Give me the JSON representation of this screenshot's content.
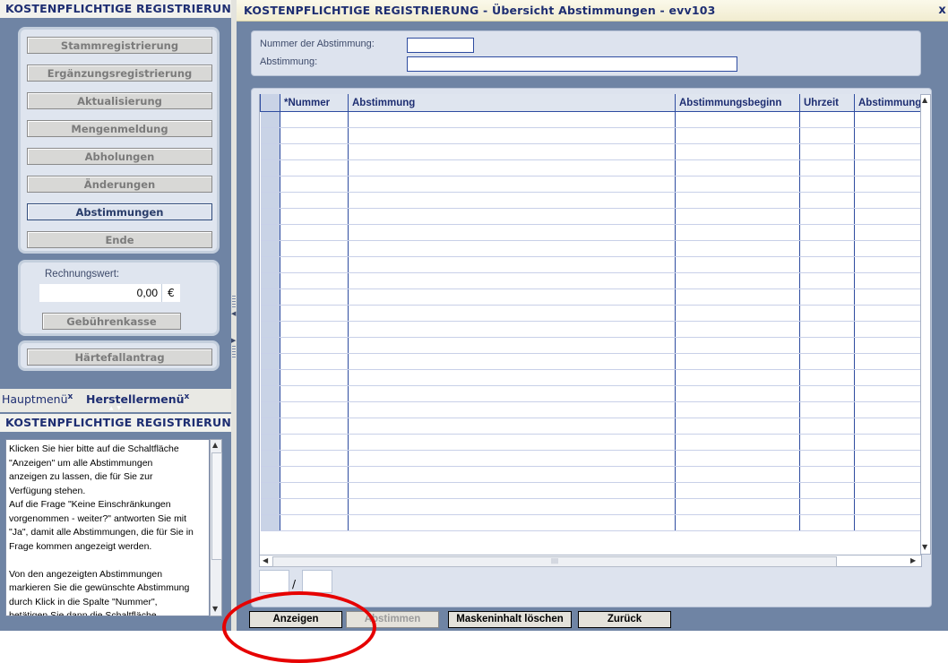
{
  "left": {
    "header": "KOSTENPFLICHTIGE REGISTRIERUNG",
    "nav": [
      {
        "label": "Stammregistrierung",
        "active": false
      },
      {
        "label": "Ergänzungsregistrierung",
        "active": false
      },
      {
        "label": "Aktualisierung",
        "active": false
      },
      {
        "label": "Mengenmeldung",
        "active": false
      },
      {
        "label": "Abholungen",
        "active": false
      },
      {
        "label": "Änderungen",
        "active": false
      },
      {
        "label": "Abstimmungen",
        "active": true
      },
      {
        "label": "Ende",
        "active": false
      }
    ],
    "invoice": {
      "label": "Rechnungswert:",
      "value": "0,00",
      "currency": "€",
      "button": "Gebührenkasse"
    },
    "hardship_button": "Härtefallantrag",
    "tabs": [
      {
        "label": "Hauptmenü",
        "close": "x"
      },
      {
        "label": "Herstellermenü",
        "close": "x"
      }
    ],
    "help_header": "KOSTENPFLICHTIGE REGISTRIERUNG",
    "help_lines": [
      "Klicken Sie hier bitte auf die Schaltfläche",
      "\"Anzeigen\" um alle Abstimmungen",
      "anzeigen zu lassen, die für Sie zur",
      "Verfügung stehen.",
      "Auf die Frage \"Keine Einschränkungen",
      "vorgenommen - weiter?\" antworten Sie mit",
      "\"Ja\", damit alle Abstimmungen, die für Sie in",
      "Frage kommen angezeigt werden.",
      "",
      "Von den angezeigten Abstimmungen",
      "markieren Sie die gewünschte Abstimmung",
      "durch Klick in die Spalte \"Nummer\",",
      "betätigen Sie dann die Schaltfläche"
    ]
  },
  "window": {
    "title": "KOSTENPFLICHTIGE REGISTRIERUNG - Übersicht Abstimmungen - evv103",
    "close": "x"
  },
  "filter": {
    "number_label": "Nummer der Abstimmung:",
    "number_value": "",
    "vote_label": "Abstimmung:",
    "vote_value": ""
  },
  "table": {
    "columns": [
      "*Nummer",
      "Abstimmung",
      "Abstimmungsbeginn",
      "Uhrzeit",
      "Abstimmungs"
    ],
    "row_count": 26
  },
  "pager": {
    "separator": "/"
  },
  "actions": [
    {
      "label": "Anzeigen",
      "enabled": true
    },
    {
      "label": "Abstimmen",
      "enabled": false
    },
    {
      "label": "Maskeninhalt löschen",
      "enabled": true
    },
    {
      "label": "Zurück",
      "enabled": true
    }
  ],
  "colors": {
    "background": "#6f84a4",
    "title_text": "#1e2e72",
    "grid_line": "#2e4ca0",
    "highlight_circle": "#e60000"
  }
}
